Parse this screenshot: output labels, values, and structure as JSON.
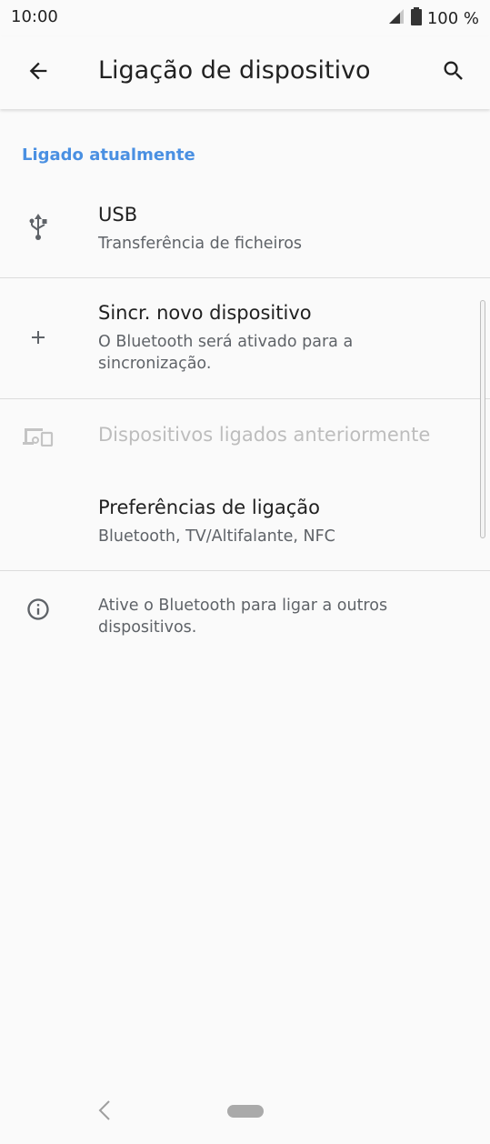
{
  "status_bar": {
    "time": "10:00",
    "battery": "100 %",
    "icons": [
      "signal-icon",
      "battery-icon"
    ]
  },
  "app_bar": {
    "title": "Ligação de dispositivo",
    "back_icon": "arrow-left-icon",
    "search_icon": "search-icon"
  },
  "section": {
    "header": "Ligado atualmente"
  },
  "rows": {
    "usb": {
      "icon": "usb-icon",
      "title": "USB",
      "subtitle": "Transferência de ficheiros"
    },
    "pair": {
      "icon": "plus-icon",
      "title": "Sincr. novo dispositivo",
      "subtitle": "O Bluetooth será ativado para a sincronização."
    },
    "previous": {
      "icon": "devices-icon",
      "title": "Dispositivos ligados anteriormente"
    },
    "preferences": {
      "title": "Preferências de ligação",
      "subtitle": "Bluetooth, TV/Altifalante, NFC"
    },
    "info": {
      "icon": "info-icon",
      "text": "Ative o Bluetooth para ligar a outros dispositivos."
    }
  },
  "colors": {
    "accent": "#4a90e2",
    "background": "#fafafa",
    "disabled_text": "#bdbdbd"
  },
  "nav_bar": {
    "icons": [
      "nav-back-icon",
      "home-pill-icon"
    ]
  }
}
